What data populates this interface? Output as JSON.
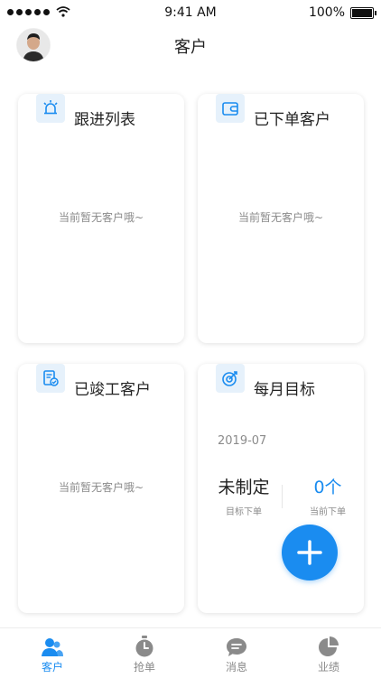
{
  "status_bar": {
    "time": "9:41 AM",
    "battery": "100%"
  },
  "header": {
    "title": "客户"
  },
  "cards": {
    "follow_up": {
      "title": "跟进列表",
      "empty": "当前暂无客户哦~"
    },
    "ordered": {
      "title": "已下单客户",
      "empty": "当前暂无客户哦~"
    },
    "completed": {
      "title": "已竣工客户",
      "empty": "当前暂无客户哦~"
    },
    "monthly_goal": {
      "title": "每月目标",
      "month": "2019-07",
      "goal_value": "未制定",
      "goal_label": "目标下单",
      "current_value": "0个",
      "current_label": "当前下单"
    }
  },
  "tabbar": {
    "items": [
      {
        "label": "客户",
        "icon": "customer-icon",
        "active": true
      },
      {
        "label": "抢单",
        "icon": "stopwatch-icon",
        "active": false
      },
      {
        "label": "消息",
        "icon": "message-icon",
        "active": false
      },
      {
        "label": "业绩",
        "icon": "pie-chart-icon",
        "active": false
      }
    ]
  },
  "colors": {
    "accent": "#1a8cf0",
    "icon_bg": "#e6f1fb",
    "muted": "#8b8b8b"
  }
}
